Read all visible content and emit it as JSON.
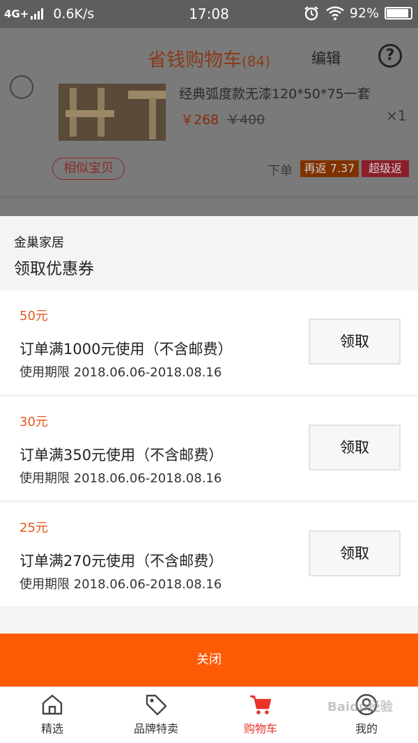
{
  "status_bar": {
    "network": "4G+",
    "speed": "0.6K/s",
    "time": "17:08",
    "battery": "92%",
    "battery_level": 0.92
  },
  "cart": {
    "title": "省钱购物车",
    "count": "(84)",
    "edit_label": "编辑",
    "help_symbol": "?",
    "item": {
      "name": "经典弧度款无漆120*50*75一套",
      "price": "￥268",
      "old_price": "￥400",
      "quantity": "×1",
      "similar_label": "相似宝贝",
      "order_label": "下单",
      "rebate": "再返 7.37",
      "super_rebate": "超级返"
    }
  },
  "coupon_sheet": {
    "shop_name": "金巢家居",
    "title": "领取优惠券",
    "coupons": [
      {
        "amount": "50元",
        "condition": "订单满1000元使用（不含邮费）",
        "validity": "使用期限 2018.06.06-2018.08.16",
        "button": "领取"
      },
      {
        "amount": "30元",
        "condition": "订单满350元使用（不含邮费）",
        "validity": "使用期限 2018.06.06-2018.08.16",
        "button": "领取"
      },
      {
        "amount": "25元",
        "condition": "订单满270元使用（不含邮费）",
        "validity": "使用期限 2018.06.06-2018.08.16",
        "button": "领取"
      }
    ],
    "close_label": "关闭"
  },
  "tab_bar": {
    "tabs": [
      {
        "label": "精选",
        "icon": "home-icon",
        "active": false
      },
      {
        "label": "品牌特卖",
        "icon": "tag-icon",
        "active": false
      },
      {
        "label": "购物车",
        "icon": "cart-icon",
        "active": true
      },
      {
        "label": "我的",
        "icon": "user-icon",
        "active": false
      }
    ]
  },
  "watermark": "Baidu经验",
  "colors": {
    "accent": "#fe5b06",
    "active_tab": "#e8322a",
    "coupon_amount": "#e5571c"
  }
}
